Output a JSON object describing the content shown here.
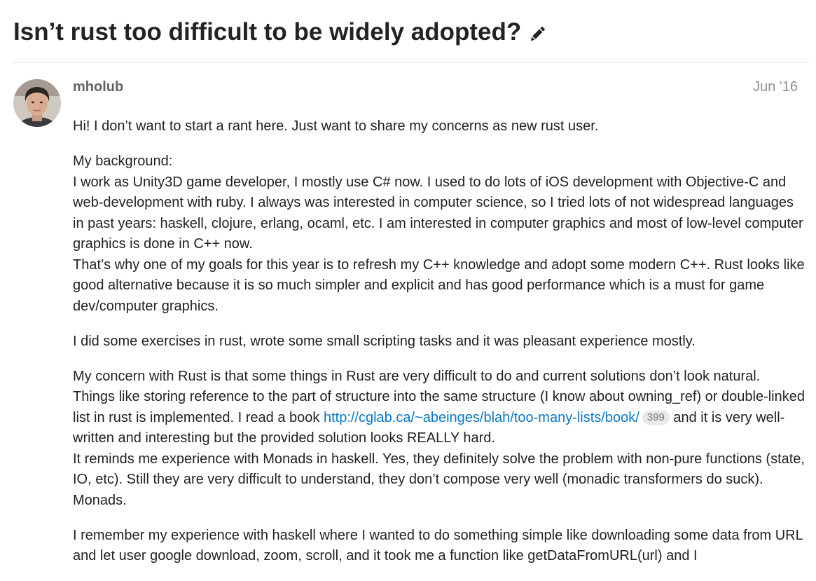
{
  "topic": {
    "title": "Isn’t rust too difficult to be widely adopted?"
  },
  "post": {
    "author": "mholub",
    "date": "Jun '16",
    "paragraphs": [
      "Hi! I don’t want to start a rant here. Just want to share my concerns as new rust user.",
      "My background:",
      "I work as Unity3D game developer, I mostly use C# now. I used to do lots of iOS development with Objective-C and web-development with ruby. I always was interested in computer science, so I tried lots of not widespread languages in past years: haskell, clojure, erlang, ocaml, etc. I am interested in computer graphics and most of low-level computer graphics is done in C++ now.",
      "That’s why one of my goals for this year is to refresh my C++ knowledge and adopt some modern C++. Rust looks like good alternative because it is so much simpler and explicit and has good performance which is a must for game dev/computer graphics.",
      "I did some exercises in rust, wrote some small scripting tasks and it was pleasant experience mostly.",
      "My concern with Rust is that some things in Rust are very difficult to do and current solutions don’t look natural. Things like storing reference to the part of structure into the same structure (I know about owning_ref) or double-linked list in rust is implemented. I read a book",
      "http://cglab.ca/~abeinges/blah/too-many-lists/book/",
      "399",
      "and it is very well-written and interesting but the provided solution looks REALLY hard.",
      "It reminds me experience with Monads in haskell. Yes, they definitely solve the problem with non-pure functions (state, IO, etc). Still they are very difficult to understand, they don’t compose very well (monadic transformers do suck). Monads.",
      "I remember my experience with haskell where I wanted to do something simple like downloading some data from URL and let user google download, zoom, scroll, and it took me a function like getDataFromURL(url) and I"
    ]
  }
}
